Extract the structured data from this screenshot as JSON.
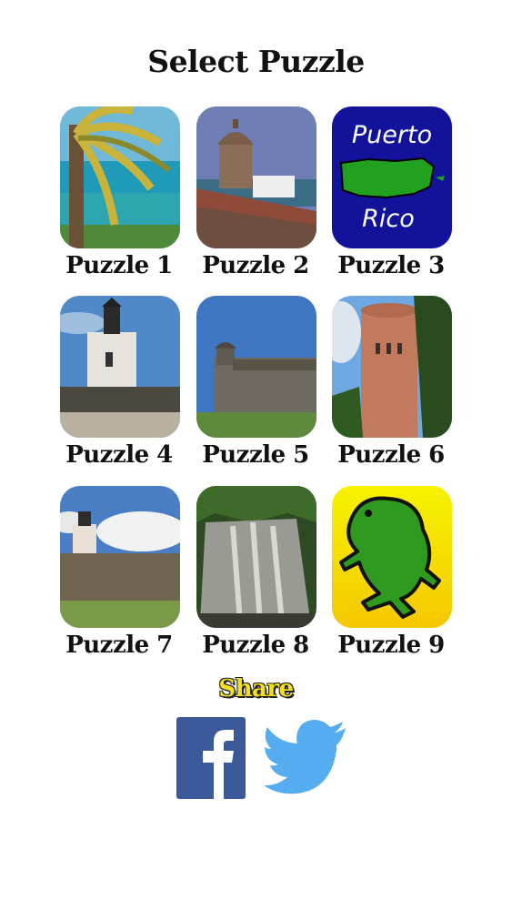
{
  "header": {
    "title": "Select Puzzle"
  },
  "puzzles": [
    {
      "label": "Puzzle 1"
    },
    {
      "label": "Puzzle 2"
    },
    {
      "label": "Puzzle 3",
      "tile_text_top": "Puerto",
      "tile_text_bottom": "Rico"
    },
    {
      "label": "Puzzle 4"
    },
    {
      "label": "Puzzle 5"
    },
    {
      "label": "Puzzle 6"
    },
    {
      "label": "Puzzle 7"
    },
    {
      "label": "Puzzle 8"
    },
    {
      "label": "Puzzle 9"
    }
  ],
  "share": {
    "label": "Share",
    "facebook_icon": "facebook-icon",
    "twitter_icon": "twitter-icon"
  },
  "colors": {
    "share_label": "#f4e020",
    "facebook": "#3b5998",
    "twitter": "#55acee",
    "puerto_rico_tile_bg": "#12129a",
    "frog_green": "#2e9a20"
  }
}
